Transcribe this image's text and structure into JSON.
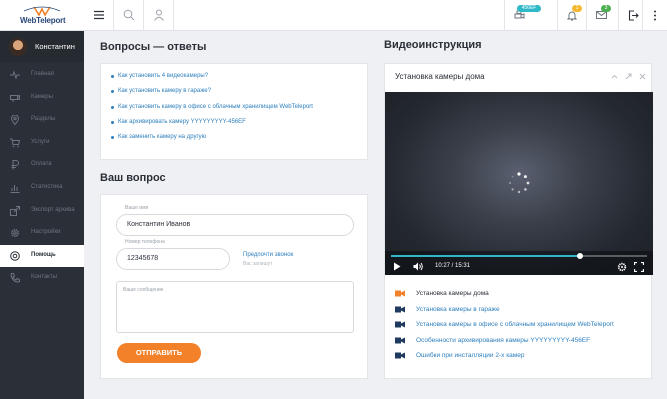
{
  "logo": {
    "text": "WebTeleport"
  },
  "user": {
    "name": "Константин"
  },
  "sidebar": {
    "items": [
      {
        "label": "Главная",
        "icon": "pulse-icon",
        "active": false
      },
      {
        "label": "Камеры",
        "icon": "camera-icon",
        "active": false
      },
      {
        "label": "Разделы",
        "icon": "pin-icon",
        "active": false
      },
      {
        "label": "Услуги",
        "icon": "cart-icon",
        "active": false
      },
      {
        "label": "Оплата",
        "icon": "ruble-icon",
        "active": false
      },
      {
        "label": "Статистика",
        "icon": "chart-icon",
        "active": false
      },
      {
        "label": "Экспорт архива",
        "icon": "export-icon",
        "active": false
      },
      {
        "label": "Настройки",
        "icon": "gear-icon",
        "active": false
      },
      {
        "label": "Помощь",
        "icon": "help-icon",
        "active": true
      },
      {
        "label": "Контакты",
        "icon": "phone-icon",
        "active": false
      }
    ]
  },
  "topbar": {
    "camera_badge": "456EF",
    "bell_badge": "1",
    "mail_badge": "3"
  },
  "faq": {
    "title": "Вопросы — ответы",
    "items": [
      "Как установить 4 видеокамеры?",
      "Как установить камеру в гараже?",
      "Как установить камеру в офисе с облачным хранилищем WebTeleport",
      "Как архивировать камеру YYYYYYYYY-456EF",
      "Как заменить камеру на другую"
    ]
  },
  "question_form": {
    "title": "Ваш вопрос",
    "name_label": "Ваше имя",
    "name_value": "Константин Иванов",
    "phone_label": "Номер телефона",
    "phone_value": "12345678",
    "link_text": "Предпочти звонок",
    "link_sub": "Вас запишут",
    "message_placeholder": "Ваше сообщение",
    "submit_label": "ОТПРАВИТЬ"
  },
  "video_section": {
    "title": "Видеоинструкция",
    "card_title": "Установка камеры дома",
    "time": "10:27 / 15:31",
    "progress": 0.74,
    "playlist": [
      {
        "label": "Установка камеры дома",
        "current": true
      },
      {
        "label": "Установка камеры в гараже",
        "current": false
      },
      {
        "label": "Установка камеры в офисе с облачным хранилищем WebTeleport",
        "current": false
      },
      {
        "label": "Особенности архивирования камеры YYYYYYYYY-456EF",
        "current": false
      },
      {
        "label": "Ошибки при инсталляции 2-х камер",
        "current": false
      }
    ]
  },
  "colors": {
    "accent": "#f2812a",
    "link": "#2e7fbd",
    "sidebar": "#2b3038",
    "progress": "#2fb8c8"
  }
}
